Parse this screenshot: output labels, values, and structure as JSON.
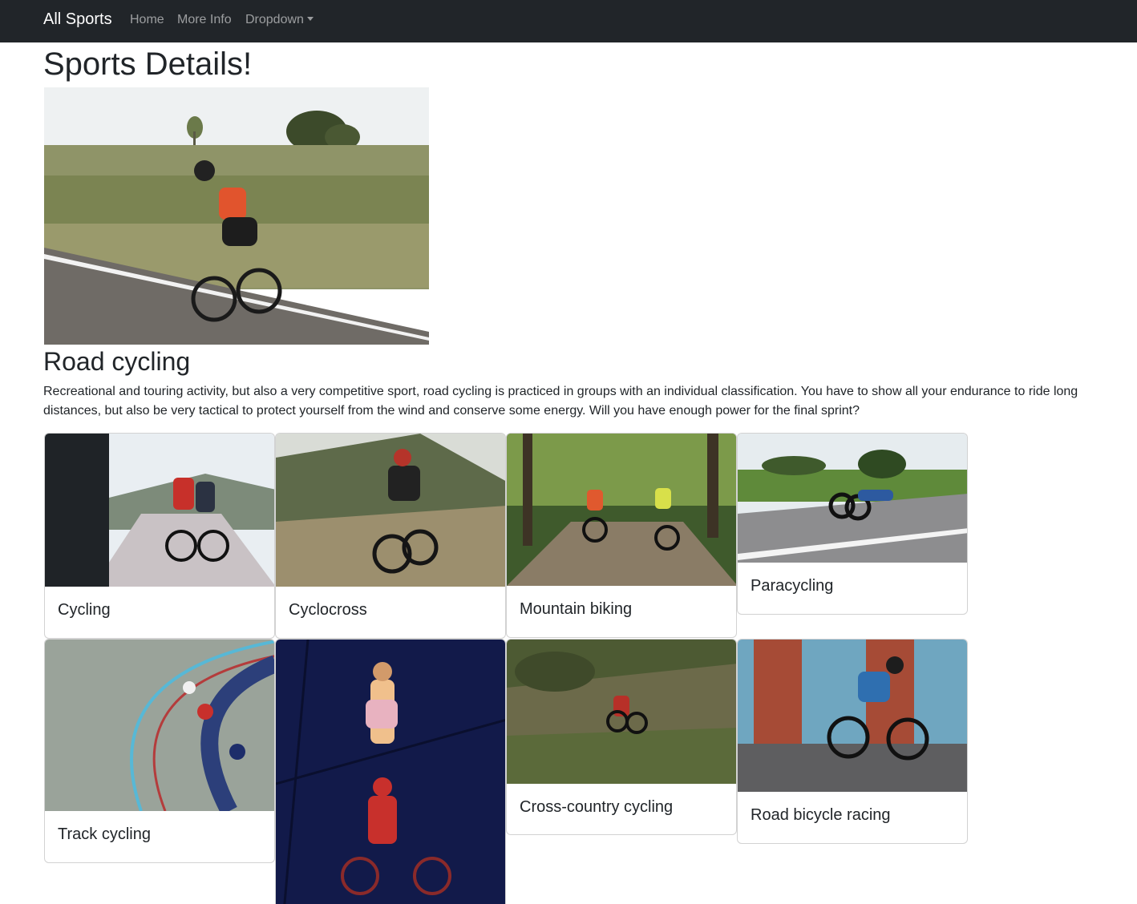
{
  "navbar": {
    "brand": "All Sports",
    "links": [
      "Home",
      "More Info",
      "Dropdown"
    ]
  },
  "page": {
    "title": "Sports Details!",
    "sport": {
      "name": "Road cycling",
      "description": "Recreational and touring activity, but also a very competitive sport, road cycling is practiced in groups with an individual classification. You have to show all your endurance to ride long distances, but also be very tactical to protect yourself from the wind and conserve some energy. Will you have enough power for the final sprint?"
    }
  },
  "cards": [
    {
      "title": "Cycling"
    },
    {
      "title": "Cyclocross"
    },
    {
      "title": "Mountain biking"
    },
    {
      "title": "Paracycling"
    },
    {
      "title": "Track cycling"
    },
    {
      "title": ""
    },
    {
      "title": "Cross-country cycling"
    },
    {
      "title": "Road bicycle racing"
    }
  ],
  "colors": {
    "navbar_bg": "#212529",
    "text": "#212529",
    "nav_link": "rgba(255,255,255,0.55)"
  },
  "icons": {
    "dropdown": "caret-down-icon"
  }
}
